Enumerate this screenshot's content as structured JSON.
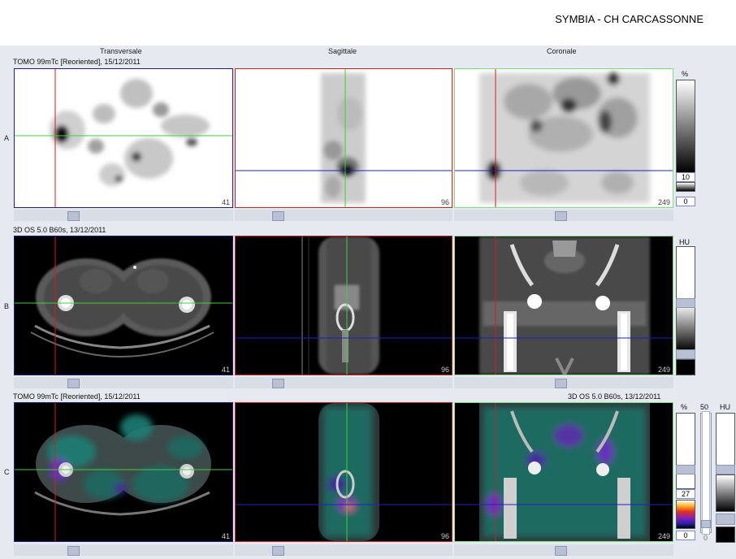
{
  "header": {
    "site": "SYMBIA - CH CARCASSONNE"
  },
  "columns": {
    "transversal": "Transversale",
    "sagittal": "Sagittale",
    "coronal": "Coronale"
  },
  "rows": {
    "a": {
      "label": "A",
      "info": "TOMO 99mTc [Reoriented], 15/12/2011"
    },
    "b": {
      "label": "B",
      "info": "3D  OS  5.0  B60s, 13/12/2011"
    },
    "c": {
      "label": "C",
      "info_left": "TOMO 99mTc [Reoriented], 15/12/2011",
      "info_right": "3D  OS  5.0  B60s, 13/12/2011"
    }
  },
  "slices": {
    "transversal": "41",
    "sagittal": "96",
    "coronal": "249"
  },
  "colorbars": {
    "a": {
      "unit": "%",
      "max": "10",
      "min": "0"
    },
    "b": {
      "unit": "HU"
    },
    "c": {
      "unit_pct": "%",
      "fusion_value": "50",
      "unit_hu": "HU",
      "max": "27",
      "min": "0",
      "hu_min": "0"
    }
  },
  "colors": {
    "accent_red": "#d02020",
    "accent_green": "#40d040",
    "accent_blue": "#2020c0",
    "frame_navy": "#20207a"
  }
}
